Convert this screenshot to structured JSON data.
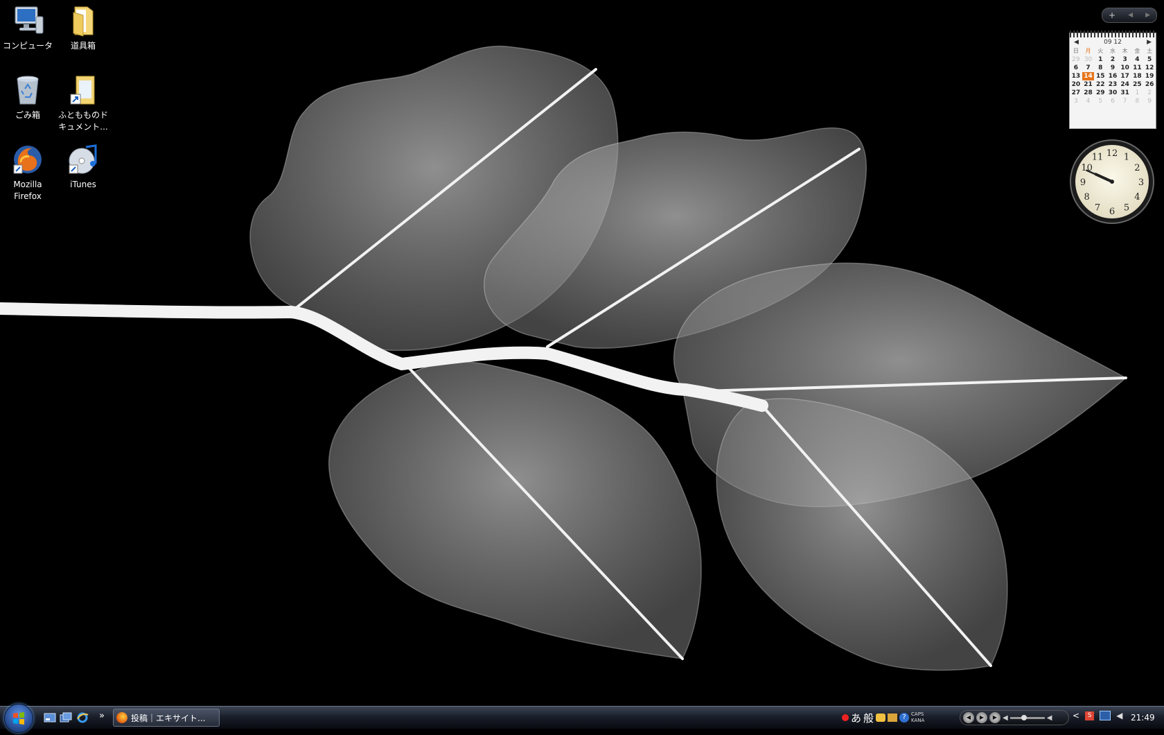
{
  "desktop": {
    "icons": [
      {
        "label": "コンピュータ",
        "icon": "computer-icon"
      },
      {
        "label": "道具箱",
        "icon": "folder-icon"
      },
      {
        "label": "ごみ箱",
        "icon": "recycle-bin-icon"
      },
      {
        "label": "ふともものド\nキュメント...",
        "icon": "documents-shortcut-icon"
      },
      {
        "label": "Mozilla\nFirefox",
        "icon": "firefox-icon"
      },
      {
        "label": "iTunes",
        "icon": "itunes-icon"
      }
    ]
  },
  "sidebar": {
    "controls": {
      "add": "+",
      "prev": "◀",
      "next": "▶"
    },
    "calendar": {
      "header": "09 12",
      "weekdays": [
        "日",
        "月",
        "火",
        "水",
        "木",
        "金",
        "土"
      ],
      "weeks": [
        [
          "29",
          "30",
          "1",
          "2",
          "3",
          "4",
          "5"
        ],
        [
          "6",
          "7",
          "8",
          "9",
          "10",
          "11",
          "12"
        ],
        [
          "13",
          "14",
          "15",
          "16",
          "17",
          "18",
          "19"
        ],
        [
          "20",
          "21",
          "22",
          "23",
          "24",
          "25",
          "26"
        ],
        [
          "27",
          "28",
          "29",
          "30",
          "31",
          "1",
          "2"
        ],
        [
          "3",
          "4",
          "5",
          "6",
          "7",
          "8",
          "9"
        ]
      ],
      "today": "14"
    },
    "clock": {
      "numbers": [
        "12",
        "1",
        "2",
        "3",
        "4",
        "5",
        "6",
        "7",
        "8",
        "9",
        "10",
        "11"
      ],
      "hour": 9,
      "minute": 49
    }
  },
  "taskbar": {
    "task_label": "投稿｜エキサイト...",
    "quicklaunch_more": "»",
    "language": {
      "hiragana": "あ",
      "mode": "般",
      "caps": "CAPS",
      "kana": "KANA"
    },
    "tray_expand": "<",
    "clock": "21:49"
  },
  "colors": {
    "accent": "#e8741a",
    "taskbar": "#1a1f2a"
  }
}
